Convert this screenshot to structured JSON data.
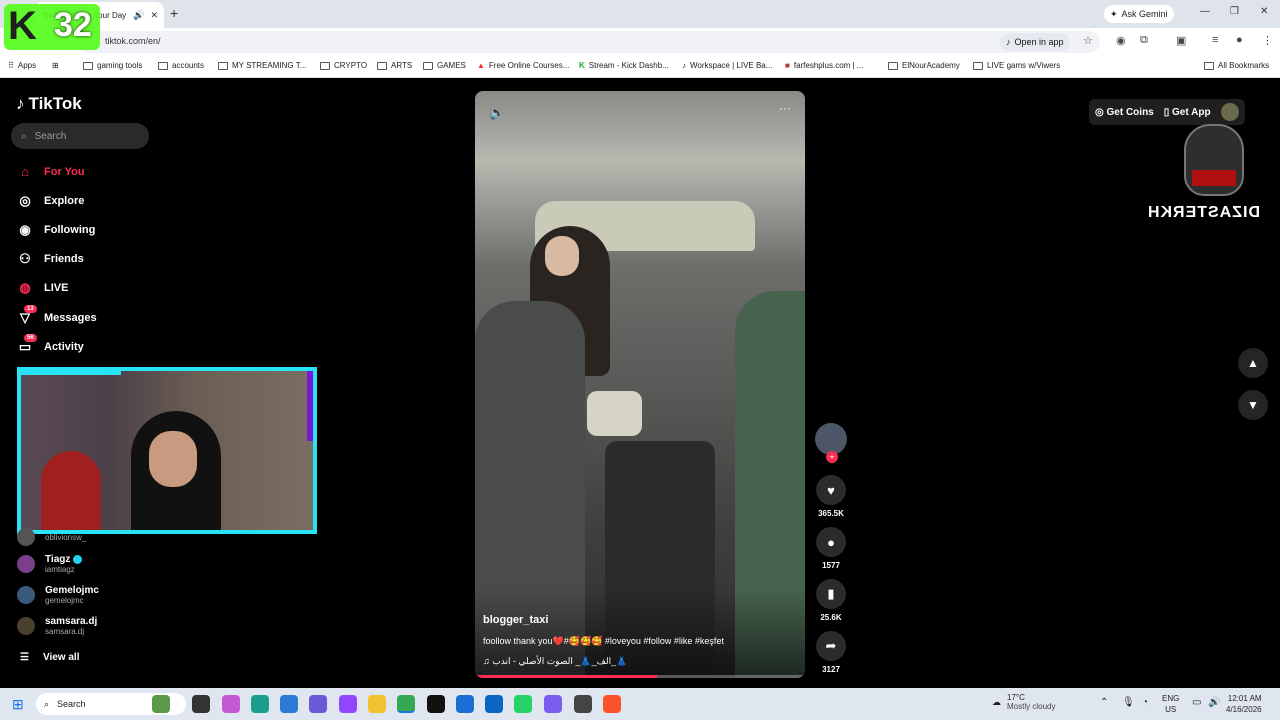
{
  "browser": {
    "tab_title": "TikTok - Make Your Day",
    "url": "tiktok.com/en/",
    "ask_gemini": "Ask Gemini",
    "open_in_app": "Open in app",
    "bookmarks": [
      "Apps",
      "gaming tools",
      "accounts",
      "MY STREAMING T...",
      "CRYPTO",
      "ARTS",
      "GAMES",
      "Free Online Courses...",
      "Stream - Kick Dashb...",
      "Workspace | LIVE Ba...",
      "farfeshplus.com | ...",
      "ElNourAcademy",
      "LIVE gams w/Viwers"
    ],
    "all_bookmarks": "All Bookmarks"
  },
  "overlay": {
    "kick_letter": "K",
    "kick_count": "32"
  },
  "sidebar": {
    "logo": "TikTok",
    "search_placeholder": "Search",
    "nav": [
      {
        "label": "For You",
        "icon": "home-icon"
      },
      {
        "label": "Explore",
        "icon": "compass-icon"
      },
      {
        "label": "Following",
        "icon": "following-icon"
      },
      {
        "label": "Friends",
        "icon": "friends-icon"
      },
      {
        "label": "LIVE",
        "icon": "live-icon"
      },
      {
        "label": "Messages",
        "icon": "messages-icon",
        "badge": "13"
      },
      {
        "label": "Activity",
        "icon": "activity-icon",
        "badge": "56"
      }
    ],
    "following_accounts": [
      {
        "name": "",
        "handle": "oblivionsw_"
      },
      {
        "name": "Tiagz",
        "handle": "iamtiagz",
        "verified": true
      },
      {
        "name": "Gemelojmc",
        "handle": "gemelojmc"
      },
      {
        "name": "samsara.dj",
        "handle": "samsara.dj"
      }
    ],
    "view_all": "View all"
  },
  "video": {
    "username": "blogger_taxi",
    "caption": "foollow thank you❤️#🥰🥰🥰 #loveyou #follow #like #keşfet",
    "music": "♫  الف_👗_ الصوت الأصلي - اندب_👗",
    "progress": 0.55
  },
  "actions": {
    "likes": "365.5K",
    "comments": "1577",
    "saves": "25.6K",
    "shares": "3127"
  },
  "topbar": {
    "get_coins": "Get Coins",
    "get_app": "Get App"
  },
  "brand_overlay": "DIZASTERKH",
  "taskbar": {
    "search": "Search",
    "weather_temp": "17°C",
    "weather_desc": "Mostly cloudy",
    "lang_top": "ENG",
    "lang_bottom": "US",
    "time": "12:01 AM",
    "date": "4/16/2026"
  }
}
